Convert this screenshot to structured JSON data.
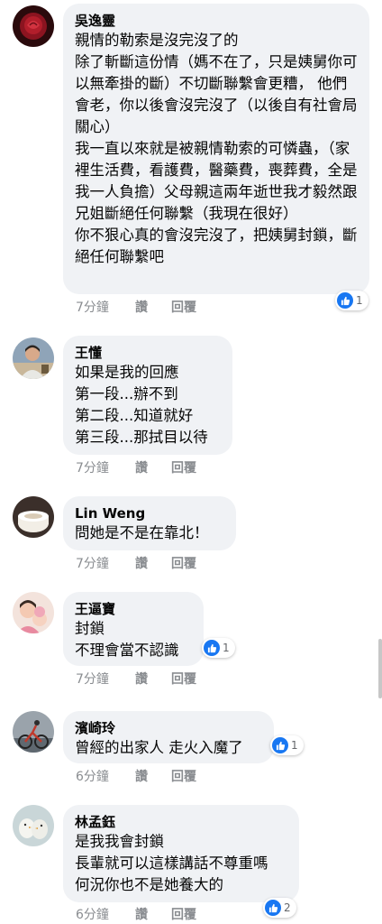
{
  "comments": [
    {
      "name": "吳逸靈",
      "text": "親情的勒索是沒完沒了的\n除了斬斷這份情（媽不在了，只是姨舅你可以無牽掛的斷）不切斷聯繫會更糟， 他們會老，你以後會沒完沒了（以後自有社會局關心）\n我一直以來就是被親情勒索的可憐蟲，（家裡生活費，看護費，醫藥費，喪葬費，全是我一人負擔）父母親這兩年逝世我才毅然跟兄姐斷絕任何聯繫（我現在很好）\n你不狠心真的會沒完沒了，把姨舅封鎖，斷絕任何聯繫吧",
      "time": "7分鐘",
      "like": "讚",
      "reply": "回覆",
      "reactions": "1"
    },
    {
      "name": "王懂",
      "text": "如果是我的回應\n第一段...辦不到\n第二段...知道就好\n第三段...那拭目以待",
      "time": "7分鐘",
      "like": "讚",
      "reply": "回覆"
    },
    {
      "name": "Lin Weng",
      "text": "問她是不是在靠北！",
      "time": "7分鐘",
      "like": "讚",
      "reply": "回覆"
    },
    {
      "name": "王逼寶",
      "text": "封鎖\n不理會當不認識",
      "time": "7分鐘",
      "like": "讚",
      "reply": "回覆",
      "reactions": "1"
    },
    {
      "name": "濱崎玲",
      "text": "曾經的出家人 走火入魔了",
      "time": "6分鐘",
      "like": "讚",
      "reply": "回覆",
      "reactions": "1"
    },
    {
      "name": "林孟鈺",
      "text": "是我我會封鎖\n長輩就可以這樣講話不尊重嗎\n何況你也不是她養大的",
      "time": "6分鐘",
      "like": "讚",
      "reply": "回覆",
      "reactions": "2"
    }
  ]
}
